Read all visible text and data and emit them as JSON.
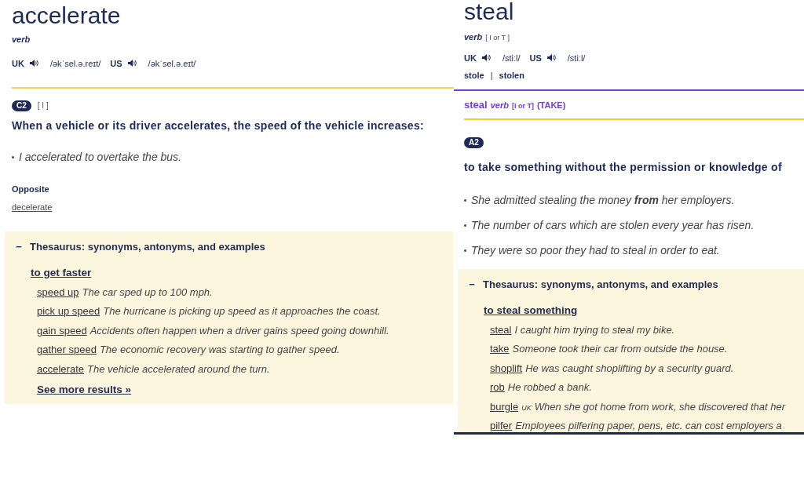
{
  "left": {
    "headword": "accelerate",
    "pos": "verb",
    "pronunciations": [
      {
        "region": "UK",
        "ipa": "/əkˈsel.ə.reɪt/"
      },
      {
        "region": "US",
        "ipa": "/əkˈsel.ə.eɪt/"
      }
    ],
    "level": "C2",
    "grammar": "[ I ]",
    "definition": "When a vehicle or its driver accelerates, the speed of the vehicle increases:",
    "examples": [
      "I accelerated to overtake the bus."
    ],
    "opposite_label": "Opposite",
    "opposite_word": "decelerate",
    "thesaurus": {
      "toggle": "−",
      "title": "Thesaurus: synonyms, antonyms, and examples",
      "sense": "to get faster",
      "entries": [
        {
          "word": "speed up",
          "example": "The car sped up to 100 mph."
        },
        {
          "word": "pick up speed",
          "example": "The hurricane is picking up speed as it approaches the coast."
        },
        {
          "word": "gain speed",
          "example": "Accidents often happen when a driver gains speed going downhill."
        },
        {
          "word": "gather speed",
          "example": "The economic recovery was starting to gather speed."
        },
        {
          "word": "accelerate",
          "example": "The vehicle accelerated around the turn."
        }
      ],
      "more": "See more results »"
    }
  },
  "right": {
    "headword": "steal",
    "pos": "verb",
    "grammar": "[ I or T ]",
    "pronunciations": [
      {
        "region": "UK",
        "ipa": "/stiːl/"
      },
      {
        "region": "US",
        "ipa": "/stiːl/"
      }
    ],
    "forms": [
      "stole",
      "stolen"
    ],
    "forms_separator": "|",
    "sense": {
      "word": "steal",
      "pos": "verb",
      "grammar": "[I or T]",
      "guide": "(TAKE)"
    },
    "level": "A2",
    "definition": "to take something without the permission or knowledge of",
    "examples": [
      "She admitted stealing the money **from** her employers.",
      "The number of cars which are stolen every year has risen.",
      "They were so poor they had to steal in order to eat."
    ],
    "thesaurus": {
      "toggle": "−",
      "title": "Thesaurus: synonyms, antonyms, and examples",
      "sense": "to steal something",
      "entries": [
        {
          "word": "steal",
          "example": "I caught him trying to steal my bike."
        },
        {
          "word": "take",
          "example": "Someone took their car from outside the house."
        },
        {
          "word": "shoplift",
          "example": "He was caught shoplifting by a security guard."
        },
        {
          "word": "rob",
          "example": "He robbed a bank."
        },
        {
          "word": "burgle",
          "label": "UK",
          "example": "When she got home from work, she discovered that her"
        },
        {
          "word": "pilfer",
          "example": "Employees pilfering paper, pens, etc. can cost employers a"
        }
      ]
    }
  }
}
